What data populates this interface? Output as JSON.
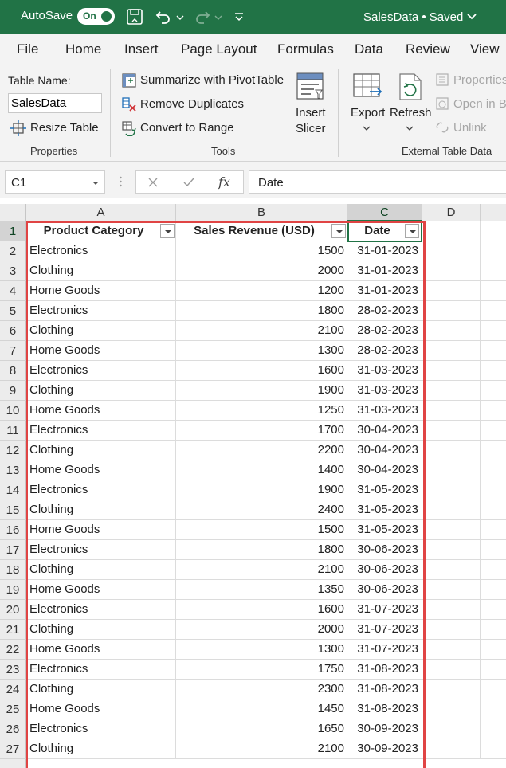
{
  "titlebar": {
    "autosave_label": "AutoSave",
    "autosave_state": "On",
    "doc_title": "SalesData • Saved",
    "bg_color": "#217346"
  },
  "menu": [
    "File",
    "Home",
    "Insert",
    "Page Layout",
    "Formulas",
    "Data",
    "Review",
    "View"
  ],
  "ribbon": {
    "properties": {
      "table_name_label": "Table Name:",
      "table_name_value": "SalesData",
      "resize_label": "Resize Table",
      "group_label": "Properties"
    },
    "tools": {
      "summarize_label": "Summarize with PivotTable",
      "remove_dup_label": "Remove Duplicates",
      "convert_label": "Convert to Range",
      "insert_slicer_line1": "Insert",
      "insert_slicer_line2": "Slicer",
      "group_label": "Tools"
    },
    "external": {
      "export_label": "Export",
      "refresh_label": "Refresh",
      "properties_label": "Properties",
      "open_browser_label": "Open in B",
      "unlink_label": "Unlink",
      "group_label": "External Table Data"
    }
  },
  "formula_bar": {
    "name_box": "C1",
    "fx_label": "fx",
    "formula": "Date"
  },
  "grid": {
    "columns": [
      "A",
      "B",
      "C",
      "D"
    ],
    "header": {
      "a": "Product Category",
      "b": "Sales Revenue (USD)",
      "c": "Date"
    },
    "rows": [
      {
        "n": "2",
        "a": "Electronics",
        "b": "1500",
        "c": "31-01-2023"
      },
      {
        "n": "3",
        "a": "Clothing",
        "b": "2000",
        "c": "31-01-2023"
      },
      {
        "n": "4",
        "a": "Home Goods",
        "b": "1200",
        "c": "31-01-2023"
      },
      {
        "n": "5",
        "a": "Electronics",
        "b": "1800",
        "c": "28-02-2023"
      },
      {
        "n": "6",
        "a": "Clothing",
        "b": "2100",
        "c": "28-02-2023"
      },
      {
        "n": "7",
        "a": "Home Goods",
        "b": "1300",
        "c": "28-02-2023"
      },
      {
        "n": "8",
        "a": "Electronics",
        "b": "1600",
        "c": "31-03-2023"
      },
      {
        "n": "9",
        "a": "Clothing",
        "b": "1900",
        "c": "31-03-2023"
      },
      {
        "n": "10",
        "a": "Home Goods",
        "b": "1250",
        "c": "31-03-2023"
      },
      {
        "n": "11",
        "a": "Electronics",
        "b": "1700",
        "c": "30-04-2023"
      },
      {
        "n": "12",
        "a": "Clothing",
        "b": "2200",
        "c": "30-04-2023"
      },
      {
        "n": "13",
        "a": "Home Goods",
        "b": "1400",
        "c": "30-04-2023"
      },
      {
        "n": "14",
        "a": "Electronics",
        "b": "1900",
        "c": "31-05-2023"
      },
      {
        "n": "15",
        "a": "Clothing",
        "b": "2400",
        "c": "31-05-2023"
      },
      {
        "n": "16",
        "a": "Home Goods",
        "b": "1500",
        "c": "31-05-2023"
      },
      {
        "n": "17",
        "a": "Electronics",
        "b": "1800",
        "c": "30-06-2023"
      },
      {
        "n": "18",
        "a": "Clothing",
        "b": "2100",
        "c": "30-06-2023"
      },
      {
        "n": "19",
        "a": "Home Goods",
        "b": "1350",
        "c": "30-06-2023"
      },
      {
        "n": "20",
        "a": "Electronics",
        "b": "1600",
        "c": "31-07-2023"
      },
      {
        "n": "21",
        "a": "Clothing",
        "b": "2000",
        "c": "31-07-2023"
      },
      {
        "n": "22",
        "a": "Home Goods",
        "b": "1300",
        "c": "31-07-2023"
      },
      {
        "n": "23",
        "a": "Electronics",
        "b": "1750",
        "c": "31-08-2023"
      },
      {
        "n": "24",
        "a": "Clothing",
        "b": "2300",
        "c": "31-08-2023"
      },
      {
        "n": "25",
        "a": "Home Goods",
        "b": "1450",
        "c": "31-08-2023"
      },
      {
        "n": "26",
        "a": "Electronics",
        "b": "1650",
        "c": "30-09-2023"
      },
      {
        "n": "27",
        "a": "Clothing",
        "b": "2100",
        "c": "30-09-2023"
      }
    ]
  },
  "colors": {
    "excel_green": "#217346",
    "highlight_outline": "#e04444"
  }
}
